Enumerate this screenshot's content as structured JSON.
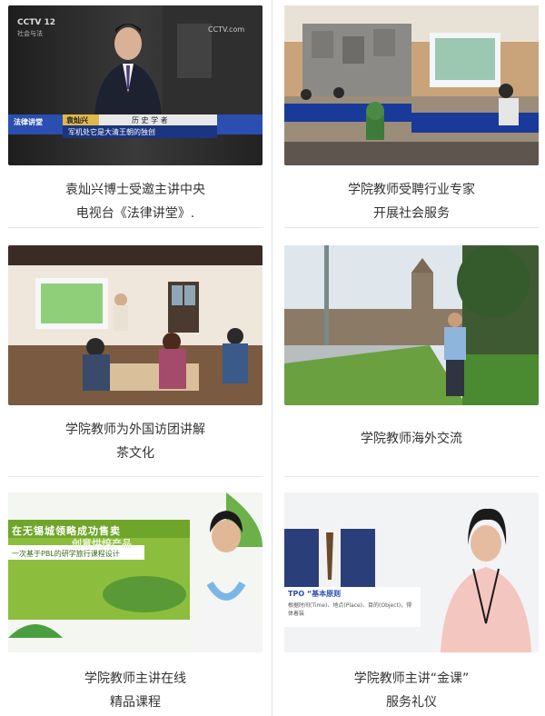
{
  "items": [
    {
      "caption_line1": "袁灿兴博士受邀主讲中央",
      "caption_line2": "电视台《法律讲堂》.",
      "overlay": {
        "logo": "CCTV 12",
        "logo_sub": "社会与法",
        "bug": "CCTV.com",
        "banner_left": "法律讲堂",
        "name": "袁灿兴",
        "title": "历 史 学 者",
        "subtitle": "军机处它是大清王朝的独创"
      }
    },
    {
      "caption_line1": "学院教师受聘行业专家",
      "caption_line2": "开展社会服务",
      "overlay": {}
    },
    {
      "caption_line1": "学院教师为外国访团讲解",
      "caption_line2": "茶文化",
      "overlay": {}
    },
    {
      "caption_line1": "学院教师海外交流",
      "caption_line2": "",
      "overlay": {}
    },
    {
      "caption_line1": "学院教师主讲在线",
      "caption_line2": "精品课程",
      "overlay": {
        "slide_line1": "在无锡城领略成功售卖",
        "slide_line2": "创意烘焙产品",
        "slide_line3": "一次基于PBL的研学旅行课程设计"
      }
    },
    {
      "caption_line1": "学院教师主讲“金课”",
      "caption_line2": "服务礼仪",
      "overlay": {
        "slide_head": "TPO “基本原则",
        "slide_text": "根据时间(Time)、地点(Place)、目的(Object)，得体着装"
      }
    }
  ],
  "colors": {
    "divider": "#dfe3e8",
    "caption": "#333333",
    "banner_blue": "#2a4fb0",
    "banner_gold": "#e0b84a"
  }
}
